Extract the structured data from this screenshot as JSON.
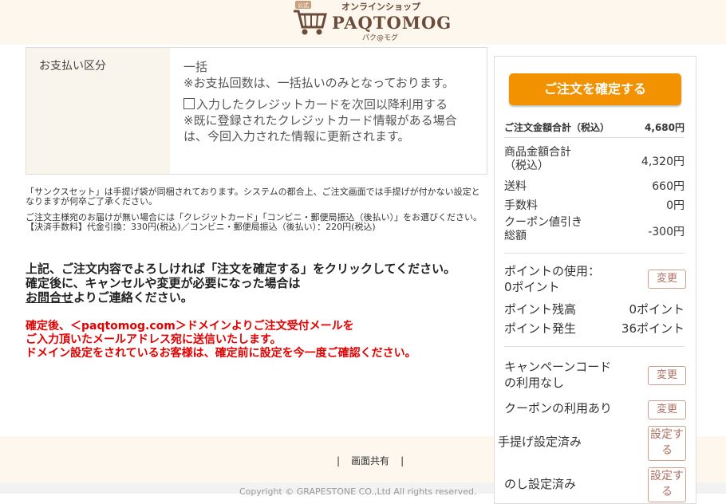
{
  "header": {
    "logo_small": "オンラインショップ",
    "logo_main": "PAQTOMOG",
    "logo_sub": "パク@モグ",
    "cart_badge": "公式"
  },
  "payment": {
    "label": "お支払い区分",
    "method": "一括",
    "note": "※お支払回数は、一括払いのみとなっております。",
    "save_card_label": "入力したクレジットカードを次回以降利用する",
    "save_card_note": "※既に登録されたクレジットカード情報がある場合は、今回入力された情報に更新されます。"
  },
  "notes": {
    "n1": "「サンクスセット」は手提げ袋が同梱されております。システムの都合上、ご注文画面では手提げが付かない設定となりますが何卒ご了承ください。",
    "n2": "ご注文主様宛のお届けが無い場合には「クレジットカード」「コンビニ・郵便局振込（後払い）」をお選びください。",
    "n3": "【決済手数料】代金引換：330円(税込)／コンビニ・郵便局振込（後払い）：220円(税込)"
  },
  "confirm": {
    "line1": "上記、ご注文内容でよろしければ「注文を確定する」をクリックしてください。",
    "line2": "確定後に、キャンセルや変更が必要になった場合は",
    "link": "お問合せ",
    "line3": "よりご連絡ください。"
  },
  "warning": {
    "line1": "確定後、＜paqtomog.com＞ドメインよりご注文受付メールを",
    "line2": "ご入力頂いたメールアドレス宛に送信いたします。",
    "line3": "ドメイン設定をされているお客様は、確定前に設定を今一度ご確認ください。"
  },
  "footer": {
    "share_label": "画面共有",
    "copyright": "Copyright © GRAPESTONE CO.,Ltd All rights reserved."
  },
  "sidebar": {
    "confirm_button": "ご注文を確定する",
    "total_label": "ご注文金額合計（税込）",
    "total_value": "4,680円",
    "subtotal_label_1": "商品金額合計",
    "subtotal_label_2": "（税込）",
    "subtotal_value": "4,320円",
    "shipping_label": "送料",
    "shipping_value": "660円",
    "fee_label": "手数料",
    "fee_value": "0円",
    "coupon_discount_label_1": "クーポン値引き",
    "coupon_discount_label_2": "総額",
    "coupon_discount_value": "-300円",
    "point_use_label_1": "ポイントの使用：",
    "point_use_label_2": "0ポイント",
    "change_label": "変更",
    "point_balance_label": "ポイント残高",
    "point_balance_value": "0ポイント",
    "point_earned_label": "ポイント発生",
    "point_earned_value": "36ポイント",
    "campaign_label_1": "キャンペーンコード",
    "campaign_label_2": "の利用なし",
    "coupon_label": "クーポンの利用あり",
    "bag_label": "手提げ設定済み",
    "noshi_label": "のし設定済み",
    "setting_label": "設定する"
  },
  "colors": {
    "accent": "#f39200",
    "warning": "#e20000",
    "header_bg": "#fdf7ee",
    "brand": "#6b4b3a"
  }
}
